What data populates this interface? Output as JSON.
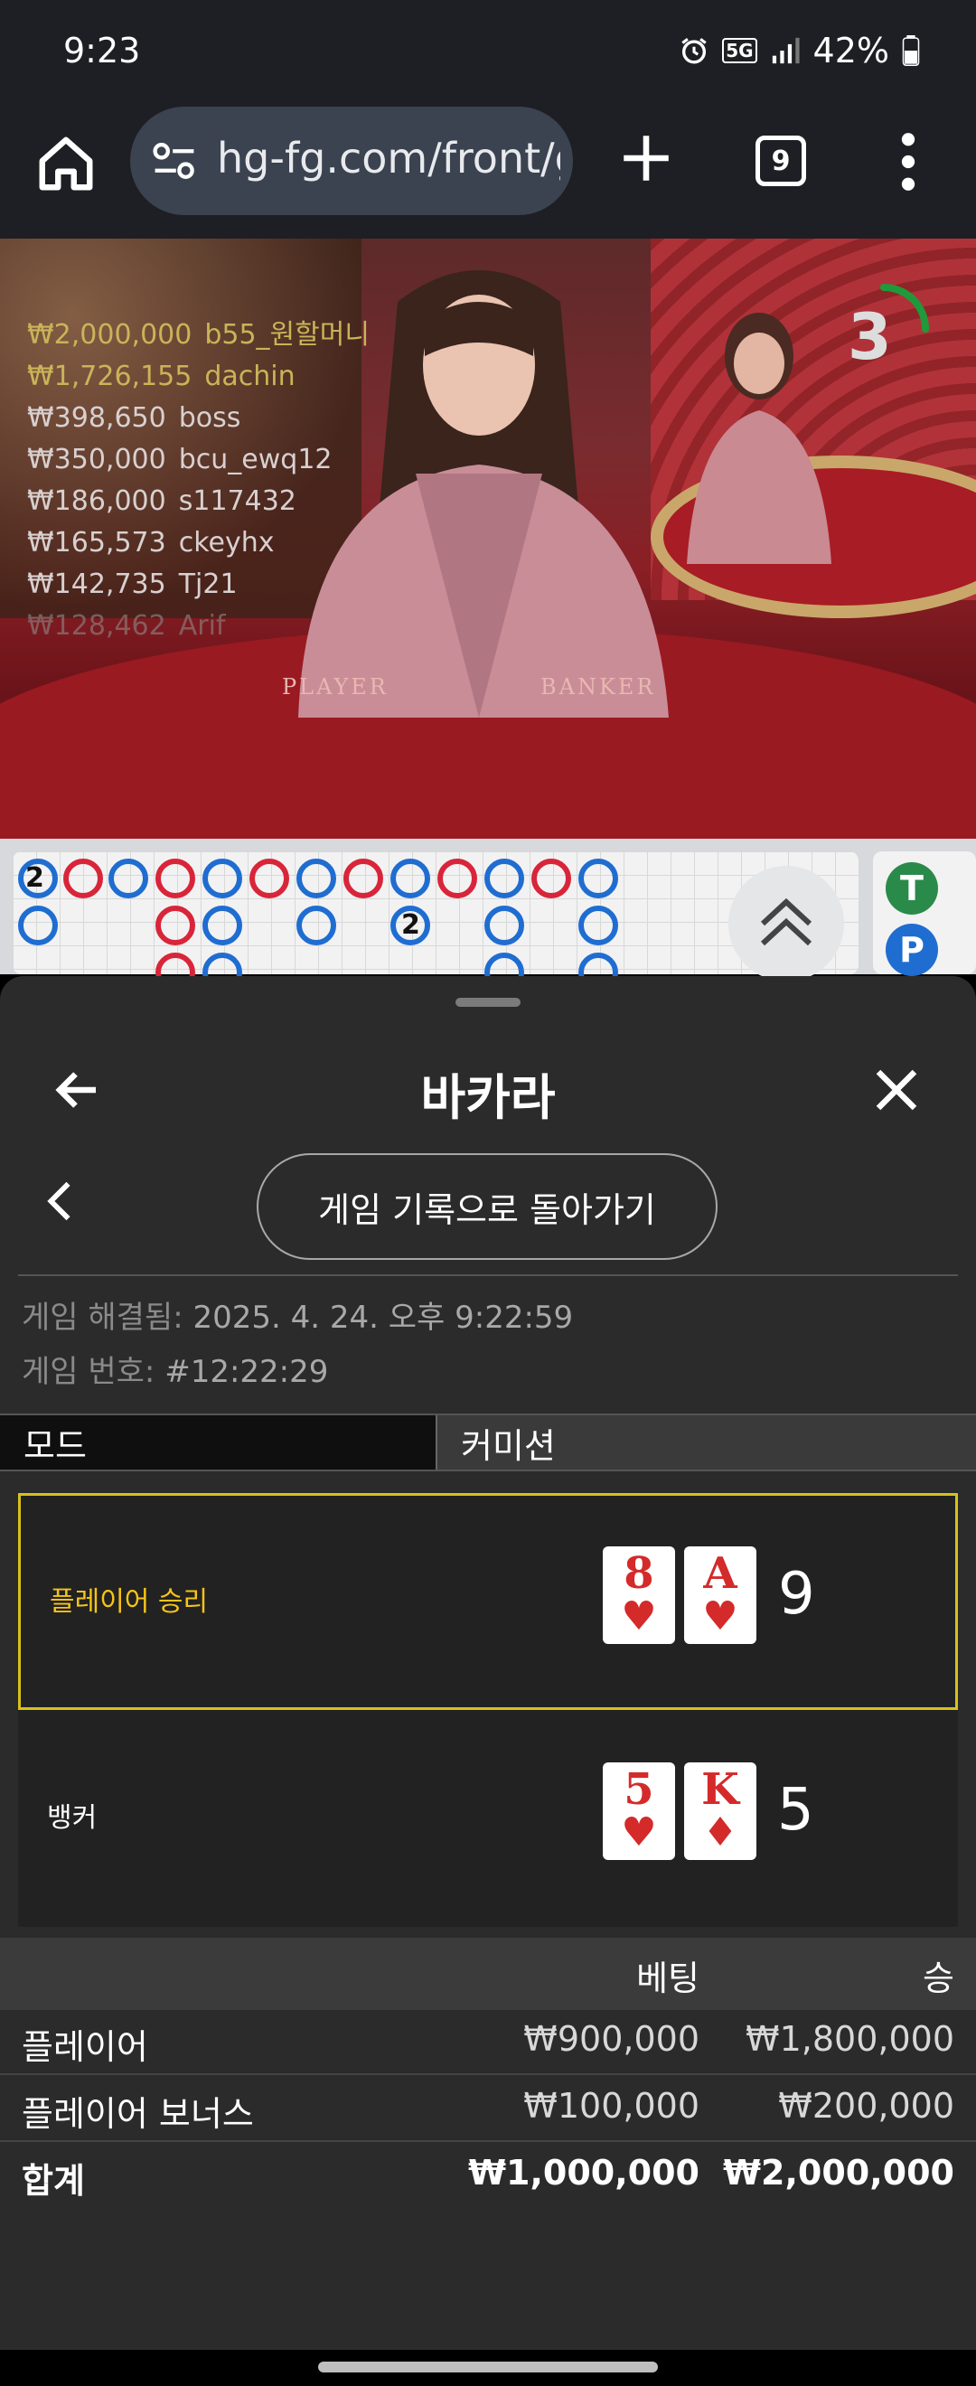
{
  "status_bar": {
    "time": "9:23",
    "network": "5G",
    "battery": "42%"
  },
  "browser": {
    "url": "hg-fg.com/front/g",
    "tab_count": "9"
  },
  "video": {
    "leaderboard": [
      {
        "amount": "₩2,000,000",
        "user": "b55_원할머니"
      },
      {
        "amount": "₩1,726,155",
        "user": "dachin"
      },
      {
        "amount": "₩398,650",
        "user": "boss"
      },
      {
        "amount": "₩350,000",
        "user": "bcu_ewq12"
      },
      {
        "amount": "₩186,000",
        "user": "s117432"
      },
      {
        "amount": "₩165,573",
        "user": "ckeyhx"
      },
      {
        "amount": "₩142,735",
        "user": "Tj21"
      },
      {
        "amount": "₩128,462",
        "user": "Arif"
      }
    ],
    "player_label": "PLAYER",
    "banker_label": "BANKER",
    "countdown": "3"
  },
  "roadmap": {
    "tie_label": "T",
    "player_label": "P",
    "tie_marker": "2"
  },
  "sheet": {
    "title": "바카라",
    "return_button": "게임 기록으로 돌아가기",
    "resolved_label": "게임 해결됨:",
    "resolved_value": "2025. 4. 24. 오후 9:22:59",
    "game_number_label": "게임 번호:",
    "game_number_value": "#12:22:29",
    "tabs": [
      {
        "label": "모드"
      },
      {
        "label": "커미션"
      }
    ],
    "results": [
      {
        "label": "플레이어 승리",
        "label_color": "#f5c518",
        "cards": [
          {
            "rank": "8",
            "suit": "♥"
          },
          {
            "rank": "A",
            "suit": "♥"
          }
        ],
        "total": "9"
      },
      {
        "label": "뱅커",
        "label_color": "#ffffff",
        "cards": [
          {
            "rank": "5",
            "suit": "♥"
          },
          {
            "rank": "K",
            "suit": "♦"
          }
        ],
        "total": "5"
      }
    ],
    "table": {
      "header_bet": "베팅",
      "header_win": "승",
      "rows": [
        {
          "name": "플레이어",
          "bet": "₩900,000",
          "win": "₩1,800,000"
        },
        {
          "name": "플레이어 보너스",
          "bet": "₩100,000",
          "win": "₩200,000"
        }
      ],
      "total": {
        "name": "합계",
        "bet": "₩1,000,000",
        "win": "₩2,000,000"
      }
    }
  }
}
